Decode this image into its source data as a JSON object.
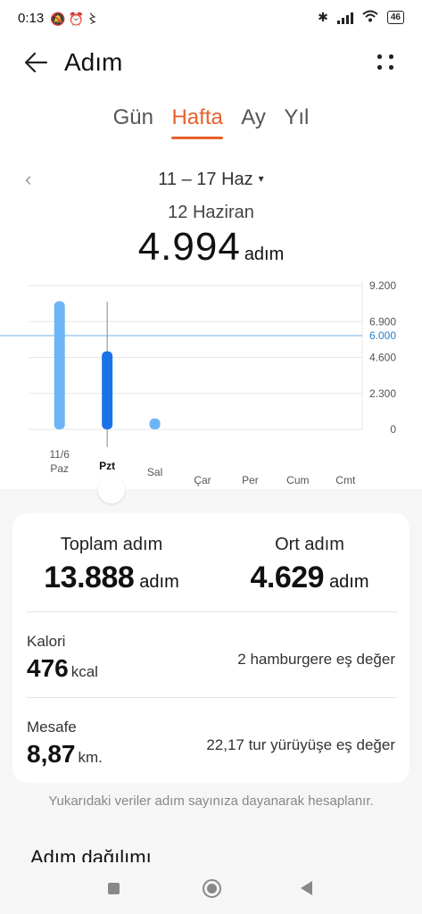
{
  "status_bar": {
    "time": "0:13",
    "icons": [
      "mute-icon",
      "alarm-icon",
      "nfc-icon"
    ],
    "right_icons": [
      "bluetooth-icon",
      "signal-icon",
      "wifi-icon"
    ],
    "battery": "46"
  },
  "header": {
    "title": "Adım",
    "back_icon": "arrow-left-icon",
    "menu_icon": "more-icon"
  },
  "tabs": [
    {
      "label": "Gün",
      "active": false
    },
    {
      "label": "Hafta",
      "active": true
    },
    {
      "label": "Ay",
      "active": false
    },
    {
      "label": "Yıl",
      "active": false
    }
  ],
  "range": {
    "label": "11 – 17 Haz",
    "caret": "▾",
    "prev": "‹"
  },
  "selected": {
    "date": "12 Haziran",
    "value": "4.994",
    "unit": "adım"
  },
  "chart_data": {
    "type": "bar",
    "categories": [
      "Paz",
      "Pzt",
      "Sal",
      "Çar",
      "Per",
      "Cum",
      "Cmt"
    ],
    "values": [
      8200,
      4994,
      694,
      0,
      0,
      0,
      0
    ],
    "first_date_label": "11/6",
    "selected_index": 1,
    "y_ticks": [
      "9.200",
      "6.900",
      "4.600",
      "2.300",
      "0"
    ],
    "y_tick_values": [
      9200,
      6900,
      4600,
      2300,
      0
    ],
    "ylim": [
      0,
      9200
    ],
    "goal": {
      "value": 6000,
      "label": "6.000",
      "color": "#2b7fc8"
    },
    "colors": {
      "bar": "#6db5f7",
      "selected_bar": "#1a73e8",
      "grid": "#e6e6e6"
    }
  },
  "summary": {
    "total": {
      "label": "Toplam adım",
      "value": "13.888",
      "unit": "adım"
    },
    "average": {
      "label": "Ort adım",
      "value": "4.629",
      "unit": "adım"
    }
  },
  "calories": {
    "label": "Kalori",
    "value": "476",
    "unit": "kcal",
    "equivalent": "2 hamburgere eş değer"
  },
  "distance": {
    "label": "Mesafe",
    "value": "8,87",
    "unit": "km.",
    "equivalent": "22,17 tur yürüyüşe eş değer"
  },
  "note": "Yukarıdaki veriler adım sayınıza dayanarak hesaplanır.",
  "distribution_title": "Adım dağılımı",
  "navbar": {
    "icons": [
      "recent-apps-icon",
      "home-icon",
      "back-icon"
    ]
  },
  "accent": "#e8612c"
}
